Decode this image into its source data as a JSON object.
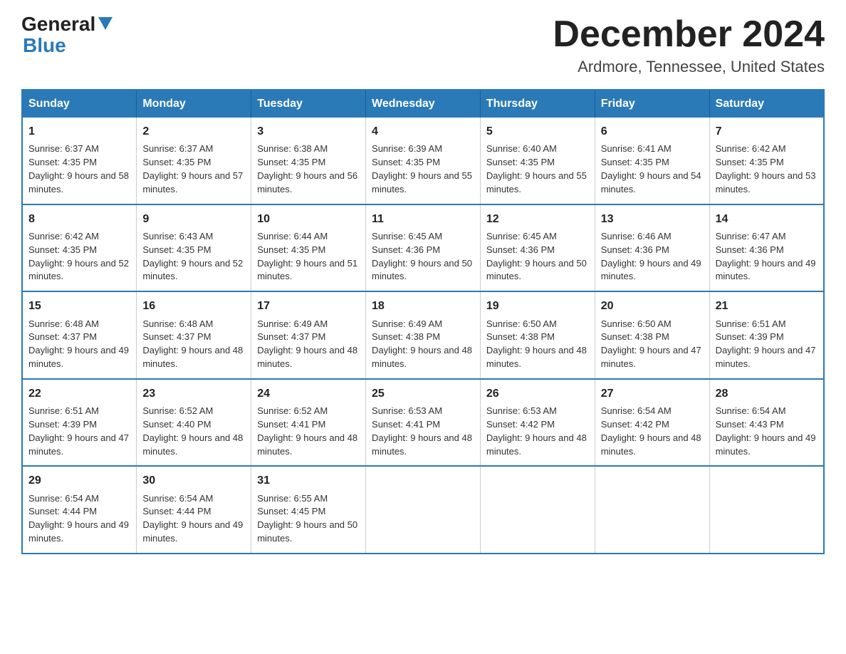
{
  "logo": {
    "general": "General",
    "blue": "Blue"
  },
  "title": "December 2024",
  "subtitle": "Ardmore, Tennessee, United States",
  "days_of_week": [
    "Sunday",
    "Monday",
    "Tuesday",
    "Wednesday",
    "Thursday",
    "Friday",
    "Saturday"
  ],
  "weeks": [
    [
      {
        "day": "1",
        "sunrise": "6:37 AM",
        "sunset": "4:35 PM",
        "daylight": "9 hours and 58 minutes."
      },
      {
        "day": "2",
        "sunrise": "6:37 AM",
        "sunset": "4:35 PM",
        "daylight": "9 hours and 57 minutes."
      },
      {
        "day": "3",
        "sunrise": "6:38 AM",
        "sunset": "4:35 PM",
        "daylight": "9 hours and 56 minutes."
      },
      {
        "day": "4",
        "sunrise": "6:39 AM",
        "sunset": "4:35 PM",
        "daylight": "9 hours and 55 minutes."
      },
      {
        "day": "5",
        "sunrise": "6:40 AM",
        "sunset": "4:35 PM",
        "daylight": "9 hours and 55 minutes."
      },
      {
        "day": "6",
        "sunrise": "6:41 AM",
        "sunset": "4:35 PM",
        "daylight": "9 hours and 54 minutes."
      },
      {
        "day": "7",
        "sunrise": "6:42 AM",
        "sunset": "4:35 PM",
        "daylight": "9 hours and 53 minutes."
      }
    ],
    [
      {
        "day": "8",
        "sunrise": "6:42 AM",
        "sunset": "4:35 PM",
        "daylight": "9 hours and 52 minutes."
      },
      {
        "day": "9",
        "sunrise": "6:43 AM",
        "sunset": "4:35 PM",
        "daylight": "9 hours and 52 minutes."
      },
      {
        "day": "10",
        "sunrise": "6:44 AM",
        "sunset": "4:35 PM",
        "daylight": "9 hours and 51 minutes."
      },
      {
        "day": "11",
        "sunrise": "6:45 AM",
        "sunset": "4:36 PM",
        "daylight": "9 hours and 50 minutes."
      },
      {
        "day": "12",
        "sunrise": "6:45 AM",
        "sunset": "4:36 PM",
        "daylight": "9 hours and 50 minutes."
      },
      {
        "day": "13",
        "sunrise": "6:46 AM",
        "sunset": "4:36 PM",
        "daylight": "9 hours and 49 minutes."
      },
      {
        "day": "14",
        "sunrise": "6:47 AM",
        "sunset": "4:36 PM",
        "daylight": "9 hours and 49 minutes."
      }
    ],
    [
      {
        "day": "15",
        "sunrise": "6:48 AM",
        "sunset": "4:37 PM",
        "daylight": "9 hours and 49 minutes."
      },
      {
        "day": "16",
        "sunrise": "6:48 AM",
        "sunset": "4:37 PM",
        "daylight": "9 hours and 48 minutes."
      },
      {
        "day": "17",
        "sunrise": "6:49 AM",
        "sunset": "4:37 PM",
        "daylight": "9 hours and 48 minutes."
      },
      {
        "day": "18",
        "sunrise": "6:49 AM",
        "sunset": "4:38 PM",
        "daylight": "9 hours and 48 minutes."
      },
      {
        "day": "19",
        "sunrise": "6:50 AM",
        "sunset": "4:38 PM",
        "daylight": "9 hours and 48 minutes."
      },
      {
        "day": "20",
        "sunrise": "6:50 AM",
        "sunset": "4:38 PM",
        "daylight": "9 hours and 47 minutes."
      },
      {
        "day": "21",
        "sunrise": "6:51 AM",
        "sunset": "4:39 PM",
        "daylight": "9 hours and 47 minutes."
      }
    ],
    [
      {
        "day": "22",
        "sunrise": "6:51 AM",
        "sunset": "4:39 PM",
        "daylight": "9 hours and 47 minutes."
      },
      {
        "day": "23",
        "sunrise": "6:52 AM",
        "sunset": "4:40 PM",
        "daylight": "9 hours and 48 minutes."
      },
      {
        "day": "24",
        "sunrise": "6:52 AM",
        "sunset": "4:41 PM",
        "daylight": "9 hours and 48 minutes."
      },
      {
        "day": "25",
        "sunrise": "6:53 AM",
        "sunset": "4:41 PM",
        "daylight": "9 hours and 48 minutes."
      },
      {
        "day": "26",
        "sunrise": "6:53 AM",
        "sunset": "4:42 PM",
        "daylight": "9 hours and 48 minutes."
      },
      {
        "day": "27",
        "sunrise": "6:54 AM",
        "sunset": "4:42 PM",
        "daylight": "9 hours and 48 minutes."
      },
      {
        "day": "28",
        "sunrise": "6:54 AM",
        "sunset": "4:43 PM",
        "daylight": "9 hours and 49 minutes."
      }
    ],
    [
      {
        "day": "29",
        "sunrise": "6:54 AM",
        "sunset": "4:44 PM",
        "daylight": "9 hours and 49 minutes."
      },
      {
        "day": "30",
        "sunrise": "6:54 AM",
        "sunset": "4:44 PM",
        "daylight": "9 hours and 49 minutes."
      },
      {
        "day": "31",
        "sunrise": "6:55 AM",
        "sunset": "4:45 PM",
        "daylight": "9 hours and 50 minutes."
      },
      null,
      null,
      null,
      null
    ]
  ],
  "cell_labels": {
    "sunrise": "Sunrise:",
    "sunset": "Sunset:",
    "daylight": "Daylight:"
  }
}
